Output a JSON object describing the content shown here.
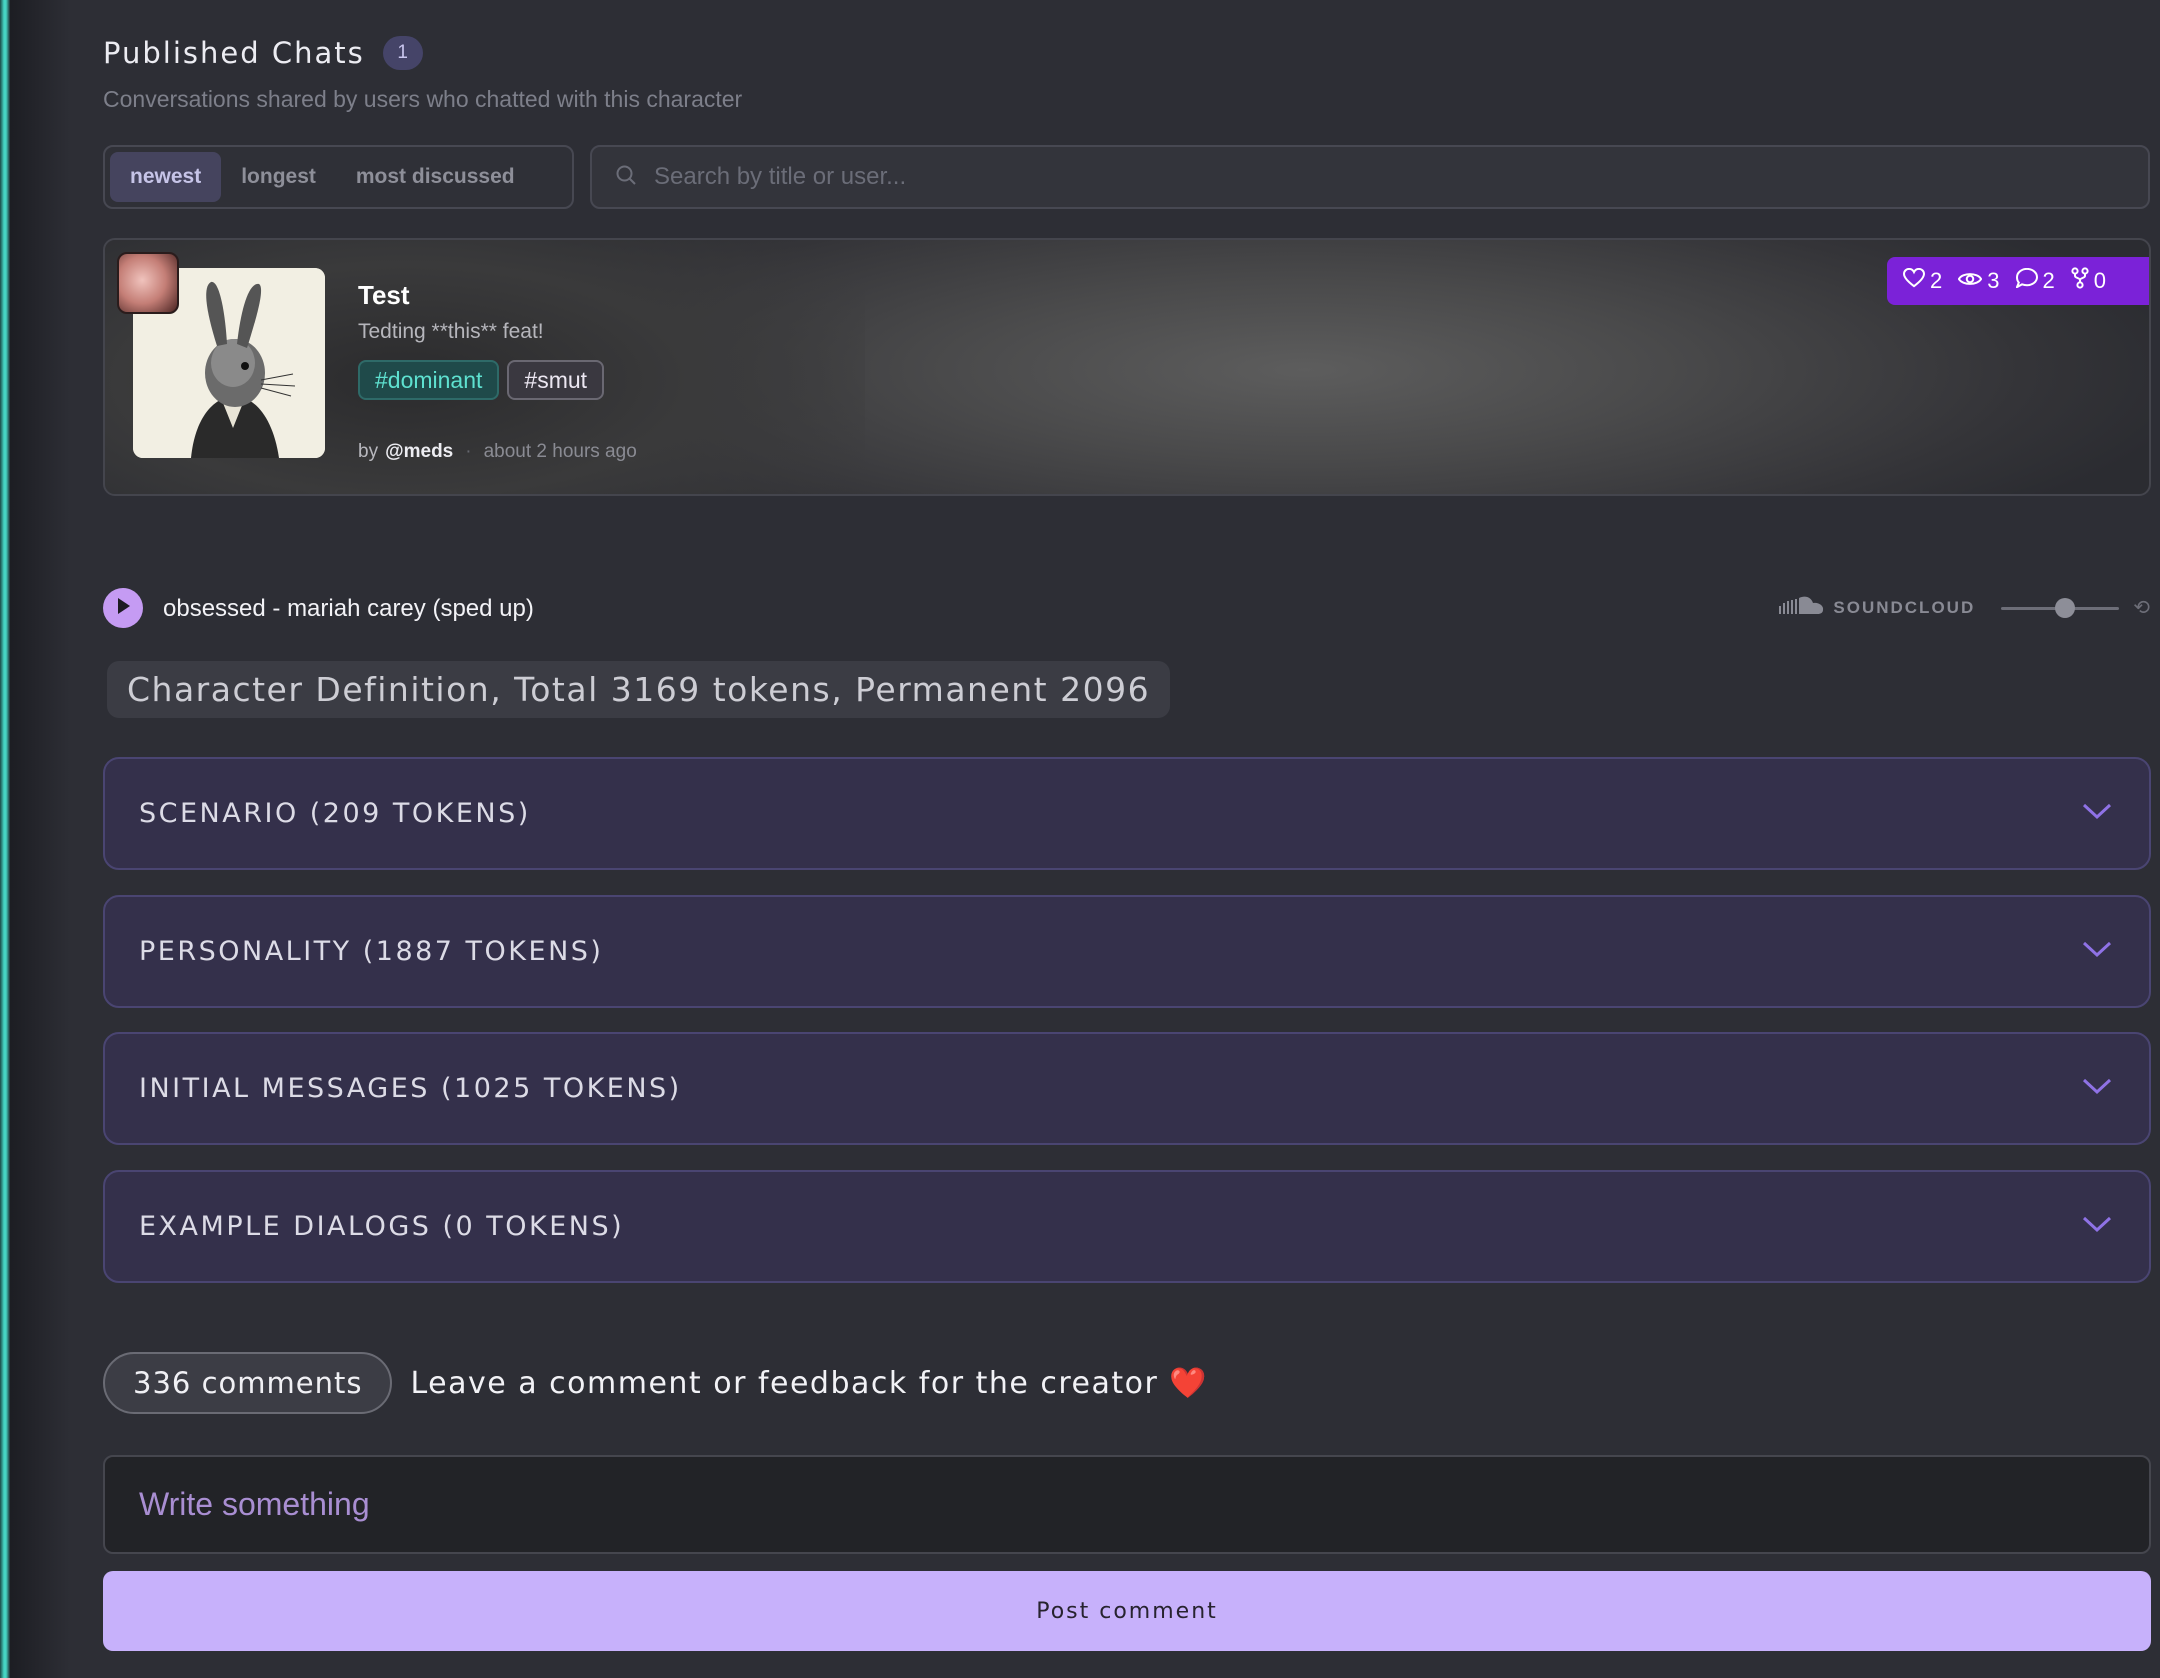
{
  "published_chats": {
    "title": "Published Chats",
    "count": "1",
    "subtitle": "Conversations shared by users who chatted with this character",
    "sort_options": [
      "newest",
      "longest",
      "most discussed"
    ],
    "active_sort": "newest",
    "search_placeholder": "Search by title or user..."
  },
  "chat_card": {
    "title": "Test",
    "description": "Tedting **this** feat!",
    "tags": [
      "#dominant",
      "#smut"
    ],
    "by_label": "by",
    "author": "@meds",
    "separator": "·",
    "time": "about 2 hours ago",
    "stats": {
      "likes": "2",
      "views": "3",
      "comments": "2",
      "forks": "0"
    }
  },
  "player": {
    "track": "obsessed - mariah carey (sped up)",
    "source": "SOUNDCLOUD",
    "volume_percent": 55
  },
  "definition": {
    "summary": "Character Definition, Total 3169 tokens, Permanent 2096",
    "sections": [
      {
        "label": "SCENARIO (209 TOKENS)"
      },
      {
        "label": "PERSONALITY (1887 TOKENS)"
      },
      {
        "label": "INITIAL MESSAGES (1025 TOKENS)"
      },
      {
        "label": "EXAMPLE DIALOGS (0 TOKENS)"
      }
    ]
  },
  "comments": {
    "count_label": "336 comments",
    "prompt": "Leave a comment or feedback for the creator ❤️",
    "input_placeholder": "Write something",
    "post_label": "Post comment"
  },
  "colors": {
    "accent_teal": "#46d4c3",
    "stats_purple": "#7b22d8",
    "post_button": "#c7b1fb",
    "accordion_bg": "#34304b"
  }
}
